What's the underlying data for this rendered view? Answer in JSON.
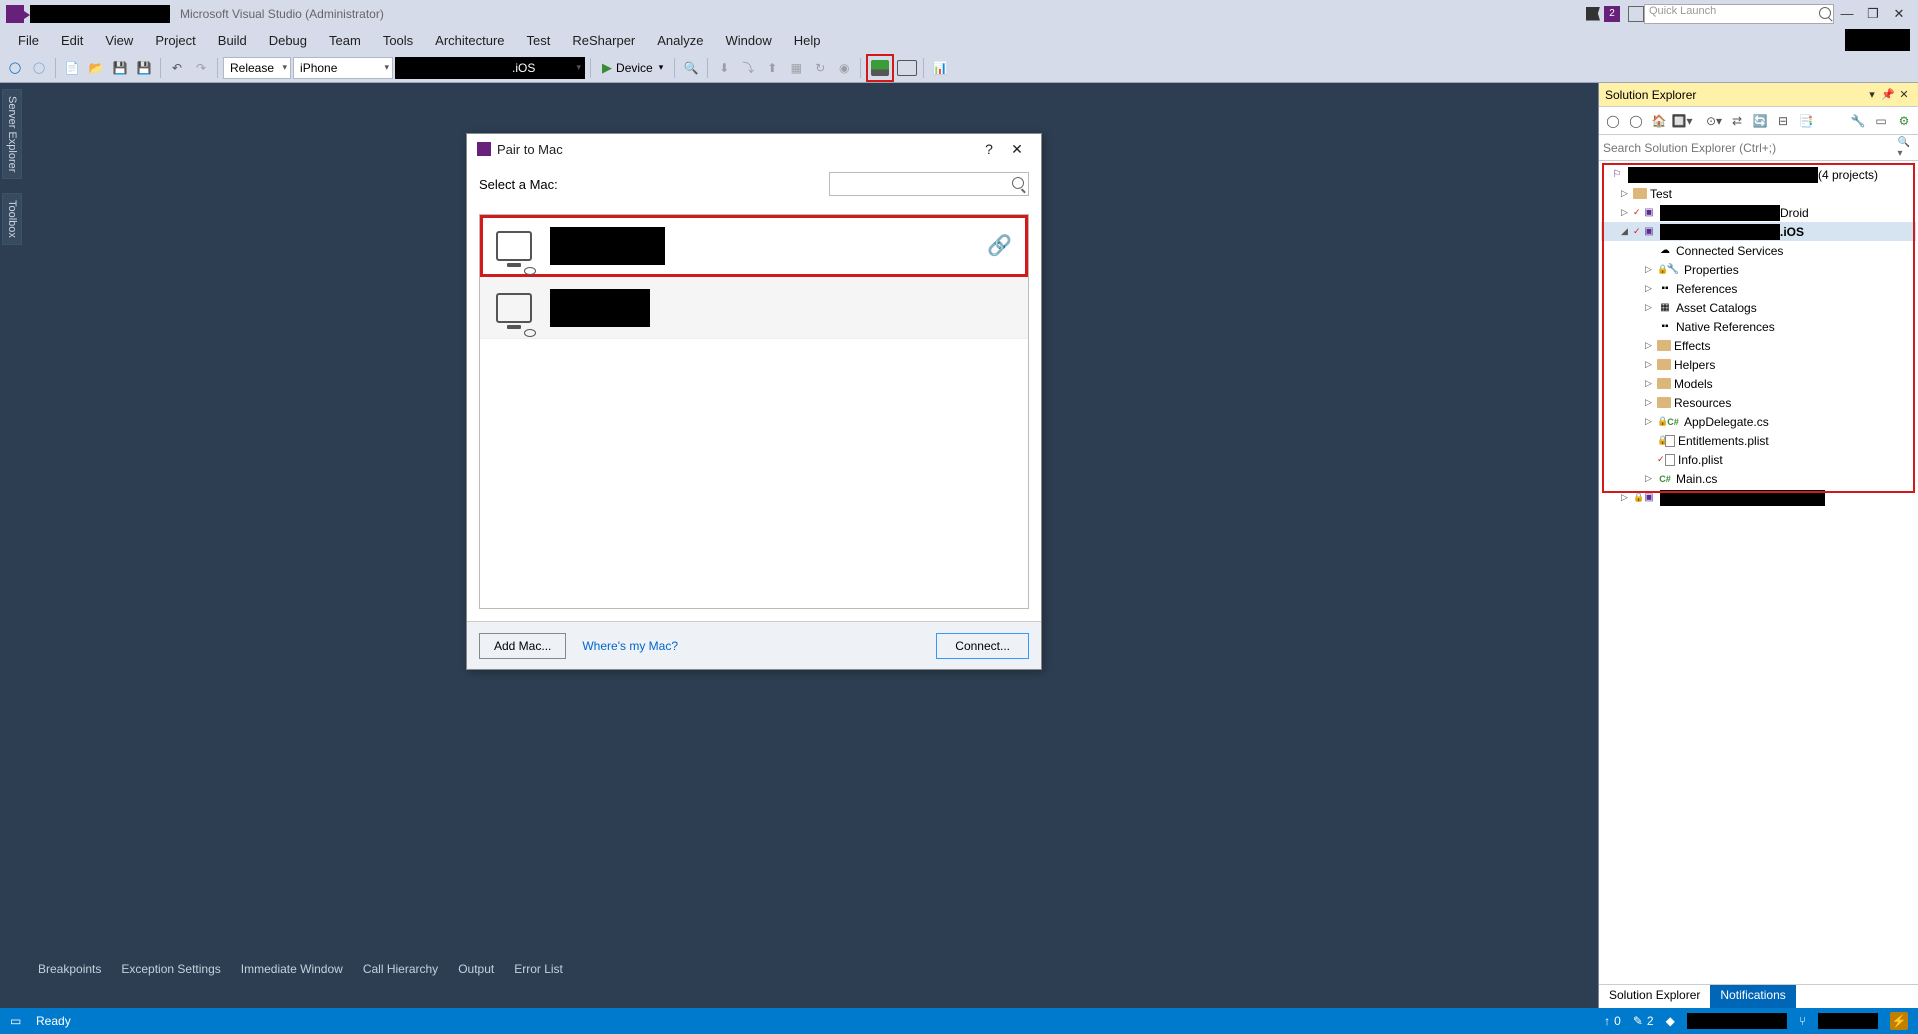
{
  "title_bar": {
    "app_title": "Microsoft Visual Studio  (Administrator)",
    "notification_count": "2",
    "quick_launch_placeholder": "Quick Launch"
  },
  "menu": [
    "File",
    "Edit",
    "View",
    "Project",
    "Build",
    "Debug",
    "Team",
    "Tools",
    "Architecture",
    "Test",
    "ReSharper",
    "Analyze",
    "Window",
    "Help"
  ],
  "toolbar": {
    "config": "Release",
    "platform": "iPhone",
    "startup_suffix": ".iOS",
    "device_label": "Device"
  },
  "side_tabs": [
    "Server Explorer",
    "Toolbox"
  ],
  "dialog": {
    "title": "Pair to Mac",
    "select_label": "Select a Mac:",
    "add_mac": "Add Mac...",
    "wheres_my_mac": "Where's my Mac?",
    "connect": "Connect...",
    "help": "?",
    "close": "✕"
  },
  "solution_explorer": {
    "title": "Solution Explorer",
    "search_placeholder": "Search Solution Explorer (Ctrl+;)",
    "solution_suffix": "(4 projects)",
    "nodes": {
      "test": "Test",
      "droid_suffix": "Droid",
      "ios_suffix": ".iOS",
      "connected_services": "Connected Services",
      "properties": "Properties",
      "references": "References",
      "asset_catalogs": "Asset Catalogs",
      "native_references": "Native References",
      "effects": "Effects",
      "helpers": "Helpers",
      "models": "Models",
      "resources": "Resources",
      "appdelegate": "AppDelegate.cs",
      "entitlements": "Entitlements.plist",
      "info_plist": "Info.plist",
      "main_cs": "Main.cs"
    },
    "bottom_tabs": [
      "Solution Explorer",
      "Notifications"
    ]
  },
  "bottom_tabs": [
    "Breakpoints",
    "Exception Settings",
    "Immediate Window",
    "Call Hierarchy",
    "Output",
    "Error List"
  ],
  "status_bar": {
    "ready": "Ready",
    "publish_count": "0",
    "changes_count": "2"
  }
}
